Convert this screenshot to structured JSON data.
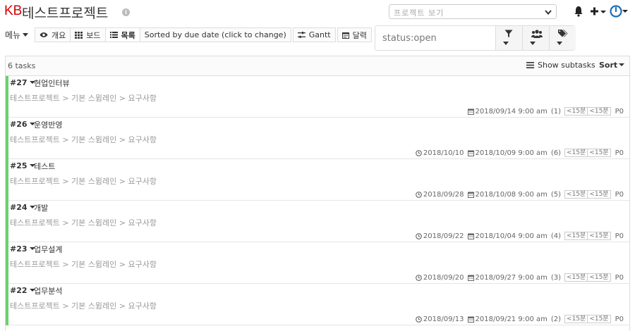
{
  "header": {
    "logo": "KB",
    "project_title": "테스트프로젝트",
    "project_select_placeholder": "프로젝트 보기"
  },
  "toolbar": {
    "menu_label": "메뉴",
    "views": [
      {
        "label": "개요",
        "icon": "eye-icon"
      },
      {
        "label": "보드",
        "icon": "board-grid-icon"
      },
      {
        "label": "목록",
        "icon": "list-icon",
        "active": true
      }
    ],
    "sort_label": "Sorted by due date (click to change)",
    "gantt_label": "Gantt",
    "calendar_label": "달력",
    "search_value": "status:open"
  },
  "list": {
    "task_count": "6 tasks",
    "show_subtasks_label": "Show subtasks",
    "sort_label": "Sort",
    "tasks": [
      {
        "id": "#27",
        "title": "현업인터뷰",
        "path": "테스트프로젝트 > 기본 스윔레인 > 요구사항",
        "start_date": "",
        "due_date": "2018/09/14 9:00 am",
        "days": "(1)",
        "estimate": "<15분",
        "spent": "<15분",
        "priority": "P0"
      },
      {
        "id": "#26",
        "title": "운영반영",
        "path": "테스트프로젝트 > 기본 스윔레인 > 요구사항",
        "start_date": "2018/10/10",
        "due_date": "2018/10/09 9:00 am",
        "days": "(6)",
        "estimate": "<15분",
        "spent": "<15분",
        "priority": "P0"
      },
      {
        "id": "#25",
        "title": "테스트",
        "path": "테스트프로젝트 > 기본 스윔레인 > 요구사항",
        "start_date": "2018/09/28",
        "due_date": "2018/10/08 9:00 am",
        "days": "(5)",
        "estimate": "<15분",
        "spent": "<15분",
        "priority": "P0"
      },
      {
        "id": "#24",
        "title": "개발",
        "path": "테스트프로젝트 > 기본 스윔레인 > 요구사항",
        "start_date": "2018/09/22",
        "due_date": "2018/10/04 9:00 am",
        "days": "(4)",
        "estimate": "<15분",
        "spent": "<15분",
        "priority": "P0"
      },
      {
        "id": "#23",
        "title": "업무설계",
        "path": "테스트프로젝트 > 기본 스윔레인 > 요구사항",
        "start_date": "2018/09/20",
        "due_date": "2018/09/27 9:00 am",
        "days": "(3)",
        "estimate": "<15분",
        "spent": "<15분",
        "priority": "P0"
      },
      {
        "id": "#22",
        "title": "업무분석",
        "path": "테스트프로젝트 > 기본 스윔레인 > 요구사항",
        "start_date": "2018/09/13",
        "due_date": "2018/09/21 9:00 am",
        "days": "(2)",
        "estimate": "<15분",
        "spent": "<15분",
        "priority": "P0"
      }
    ]
  },
  "colors": {
    "logo_red": "#d40000",
    "task_bar_green": "#6fcf6f",
    "power_blue": "#1b6fb5"
  }
}
